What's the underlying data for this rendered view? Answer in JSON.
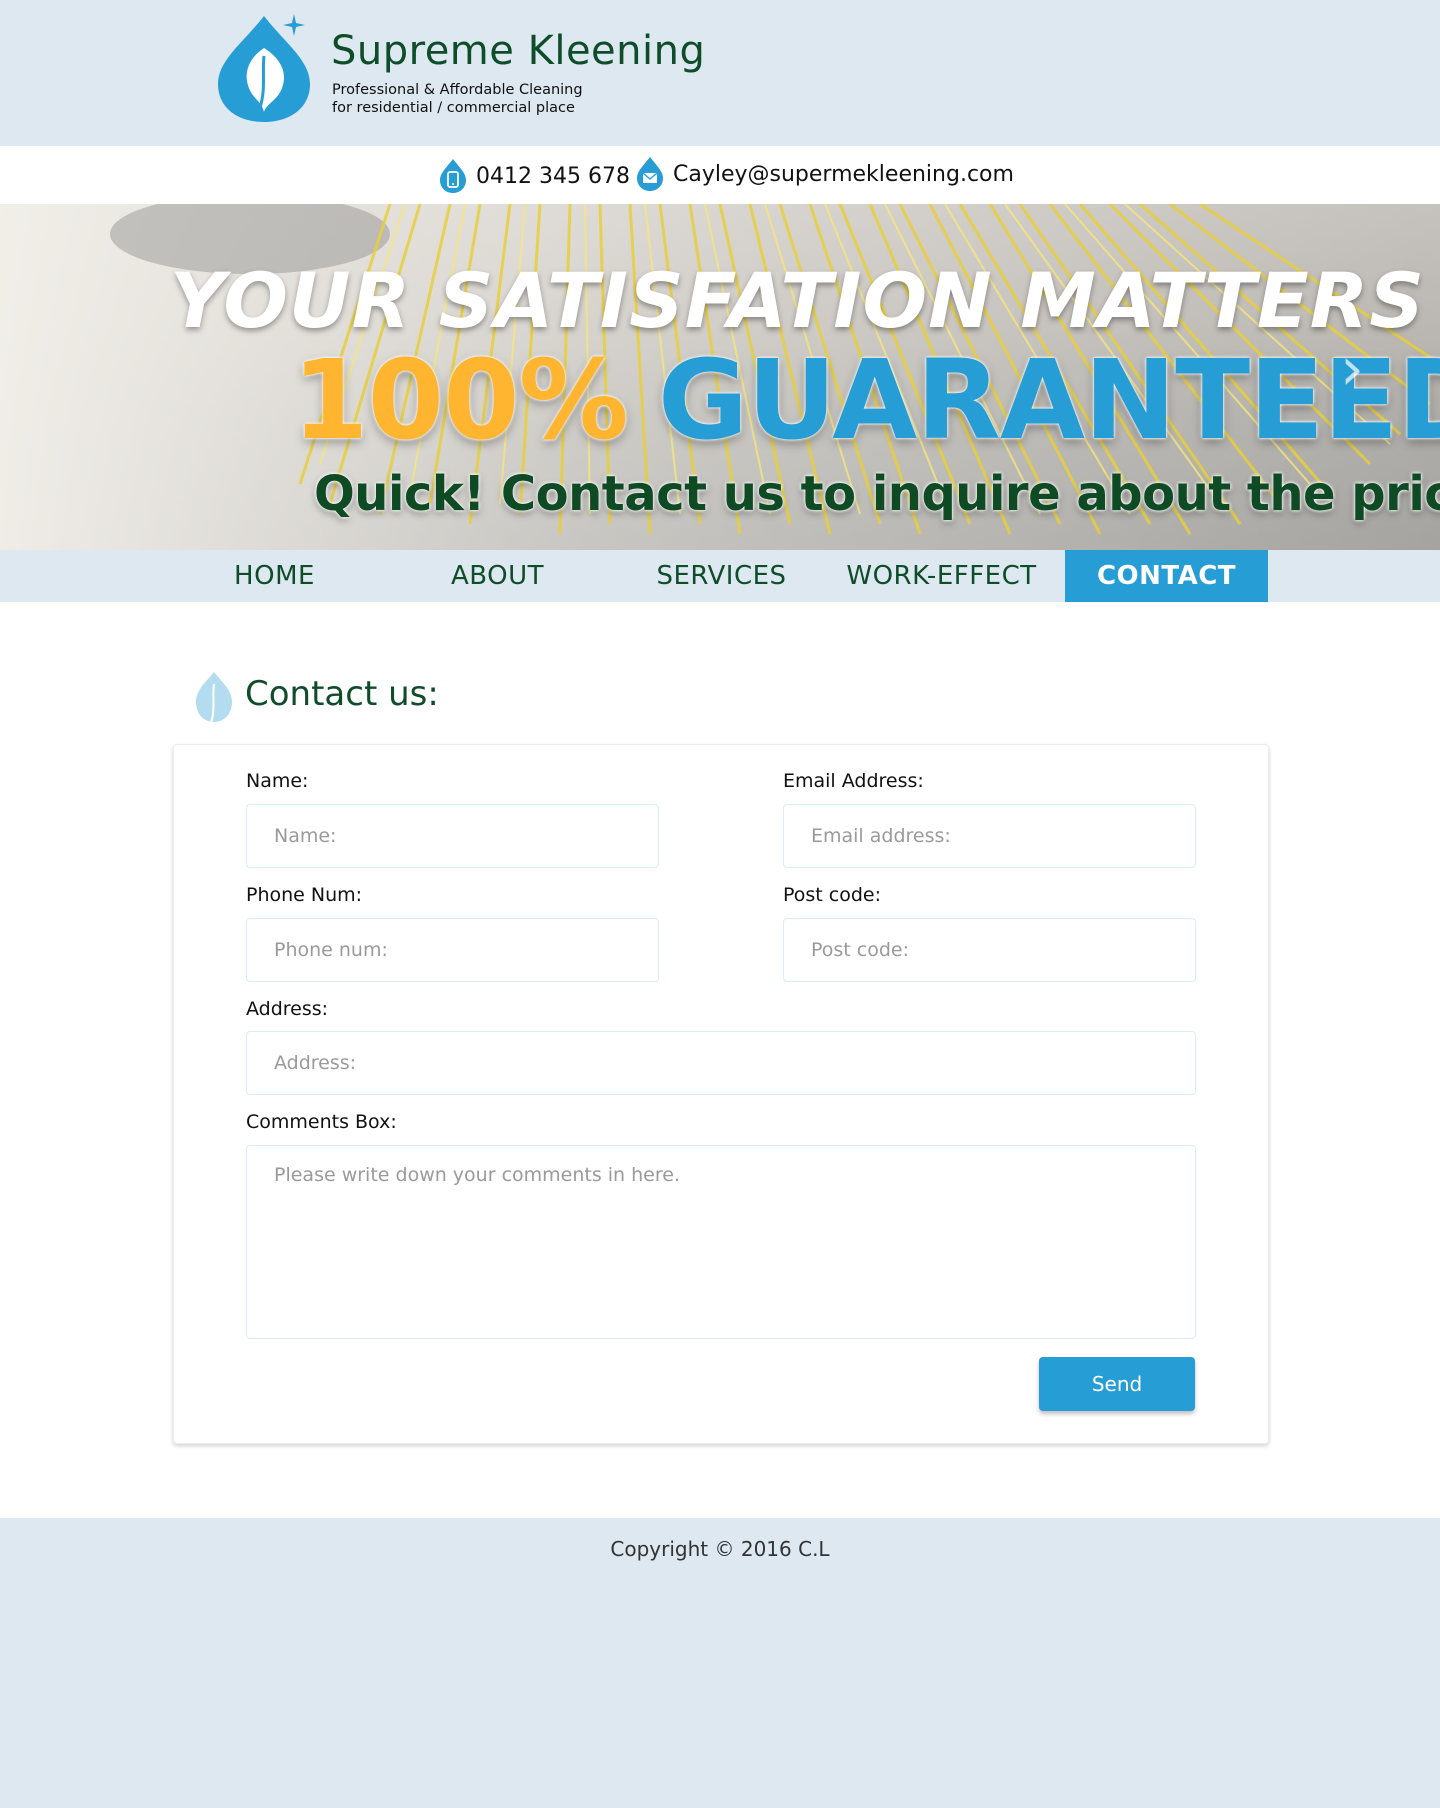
{
  "brand": {
    "name": "Supreme Kleening",
    "tagline_line1": "Professional & Affordable Cleaning",
    "tagline_line2": "for residential / commercial place",
    "logo_icon": "water-drop-leaf-icon",
    "accent_color": "#279dd6",
    "text_green": "#0f4d2a"
  },
  "contact": {
    "phone": "0412 345 678",
    "phone_icon": "phone-drop-icon",
    "email": "Cayley@supermekleening.com",
    "email_icon": "mail-drop-icon"
  },
  "banner": {
    "line1": "YOUR SATISFATION MATTERS",
    "line2_part1": "100%",
    "line2_part2": "GUARANTEED",
    "line3": "Quick! Contact us to inquire about the price!",
    "next_icon": "chevron-right-icon"
  },
  "nav": {
    "items": [
      {
        "label": "HOME",
        "active": false
      },
      {
        "label": "ABOUT",
        "active": false
      },
      {
        "label": "SERVICES",
        "active": false
      },
      {
        "label": "WORK-EFFECT",
        "active": false
      },
      {
        "label": "CONTACT",
        "active": true
      }
    ]
  },
  "contact_form": {
    "title": "Contact us:",
    "name_label": "Name:",
    "name_placeholder": "Name:",
    "email_label": "Email Address:",
    "email_placeholder": "Email address:",
    "phone_label": "Phone Num:",
    "phone_placeholder": "Phone num:",
    "postcode_label": "Post code:",
    "postcode_placeholder": "Post code:",
    "address_label": "Address:",
    "address_placeholder": "Address:",
    "comments_label": "Comments Box:",
    "comments_placeholder": "Please write down your comments in here.",
    "send_label": "Send"
  },
  "footer": {
    "copyright": "Copyright © 2016 C.L"
  }
}
